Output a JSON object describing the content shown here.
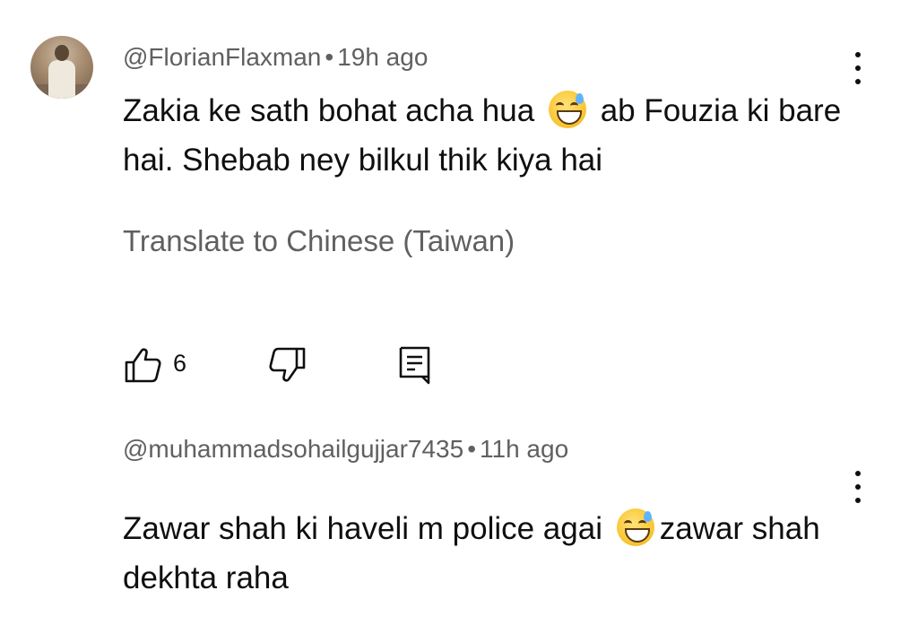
{
  "comments": [
    {
      "author": "@FlorianFlaxman",
      "time": "19h ago",
      "text_before": "Zakia ke sath bohat acha hua",
      "emoji": "grinning-face-with-sweat",
      "text_after": "ab Fouzia ki bare hai. Shebab ney bilkul thik kiya hai",
      "translate_label": "Translate to Chinese (Taiwan)",
      "like_count": "6"
    },
    {
      "author": "@muhammadsohailgujjar7435",
      "time": "11h ago",
      "text_before": "Zawar shah ki haveli m police agai",
      "emoji": "grinning-face-with-sweat",
      "text_after": "zawar shah dekhta raha"
    }
  ],
  "separator": "•",
  "icons": {
    "like": "thumb-up-icon",
    "dislike": "thumb-down-icon",
    "reply": "reply-icon",
    "more": "more-vert-icon"
  },
  "colors": {
    "primary_text": "#0f0f0f",
    "secondary_text": "#606060",
    "background": "#ffffff"
  }
}
